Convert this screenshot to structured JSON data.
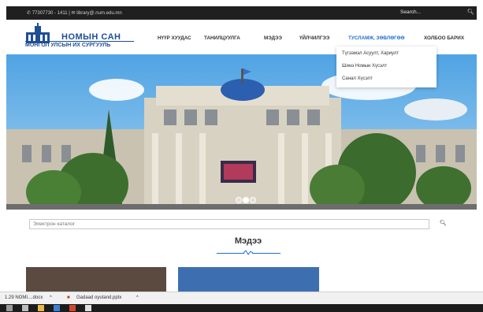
{
  "topbar": {
    "contact": "✆ 77307730 - 1411  |  ✉ library@.num.edu.mn",
    "search_label": "Search...",
    "search_icon": "search-icon"
  },
  "brand": {
    "title": "НОМЫН САН",
    "subtitle": "МОНГОЛ УЛСЫН ИХ СУРГУУЛЬ"
  },
  "nav": {
    "items": [
      "НҮҮР ХУУДАС",
      "ТАНИЛЦУУЛГА",
      "МЭДЭЭ",
      "ҮЙЛЧИЛГЭЭ",
      "ТУСЛАМЖ, ЗӨВЛӨГӨӨ",
      "ХОЛБОО БАРИХ"
    ],
    "active_index": 4,
    "active_color": "#1f6fd1"
  },
  "dropdown": {
    "items": [
      "Түгээмэл Асуулт, Хариулт",
      "Шинэ Номын Хүсэлт",
      "Санал Хүсэлт"
    ]
  },
  "carousel": {
    "slide_count": 3,
    "active_index": 1
  },
  "catalog": {
    "placeholder": "Электрон каталог",
    "search_icon": "search-icon"
  },
  "news": {
    "heading": "Мэдээ"
  },
  "downloads": {
    "items": [
      {
        "name": "1.29 NOMI....docx",
        "icon": "word-file-icon"
      },
      {
        "name": "Gadaad oyutand.pptx",
        "icon": "powerpoint-file-icon"
      }
    ],
    "chevron": "^"
  },
  "colors": {
    "brand": "#1f4e96",
    "accent": "#1f6fd1",
    "topbar": "#202020"
  }
}
